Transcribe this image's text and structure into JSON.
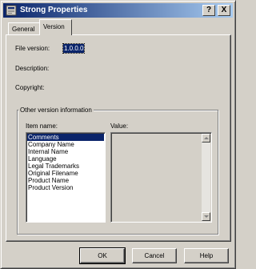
{
  "window": {
    "title": "Strong Properties"
  },
  "titlebar_buttons": {
    "help": "?",
    "close": "X"
  },
  "tabs": [
    {
      "label": "General"
    },
    {
      "label": "Version"
    }
  ],
  "version_tab": {
    "file_version_label": "File version:",
    "file_version_value": "1.0.0.0",
    "description_label": "Description:",
    "copyright_label": "Copyright:",
    "group_title": "Other version information",
    "item_name_label": "Item name:",
    "value_label": "Value:",
    "items": [
      "Comments",
      "Company Name",
      "Internal Name",
      "Language",
      "Legal Trademarks",
      "Original Filename",
      "Product Name",
      "Product Version"
    ],
    "selected_item": "Comments"
  },
  "buttons": {
    "ok": "OK",
    "cancel": "Cancel",
    "help": "Help"
  },
  "colors": {
    "titlebar_start": "#0a246a",
    "titlebar_end": "#a6caf0",
    "selection": "#0a246a",
    "face": "#d4d0c8"
  },
  "icons": {
    "title": "app-properties-icon"
  }
}
